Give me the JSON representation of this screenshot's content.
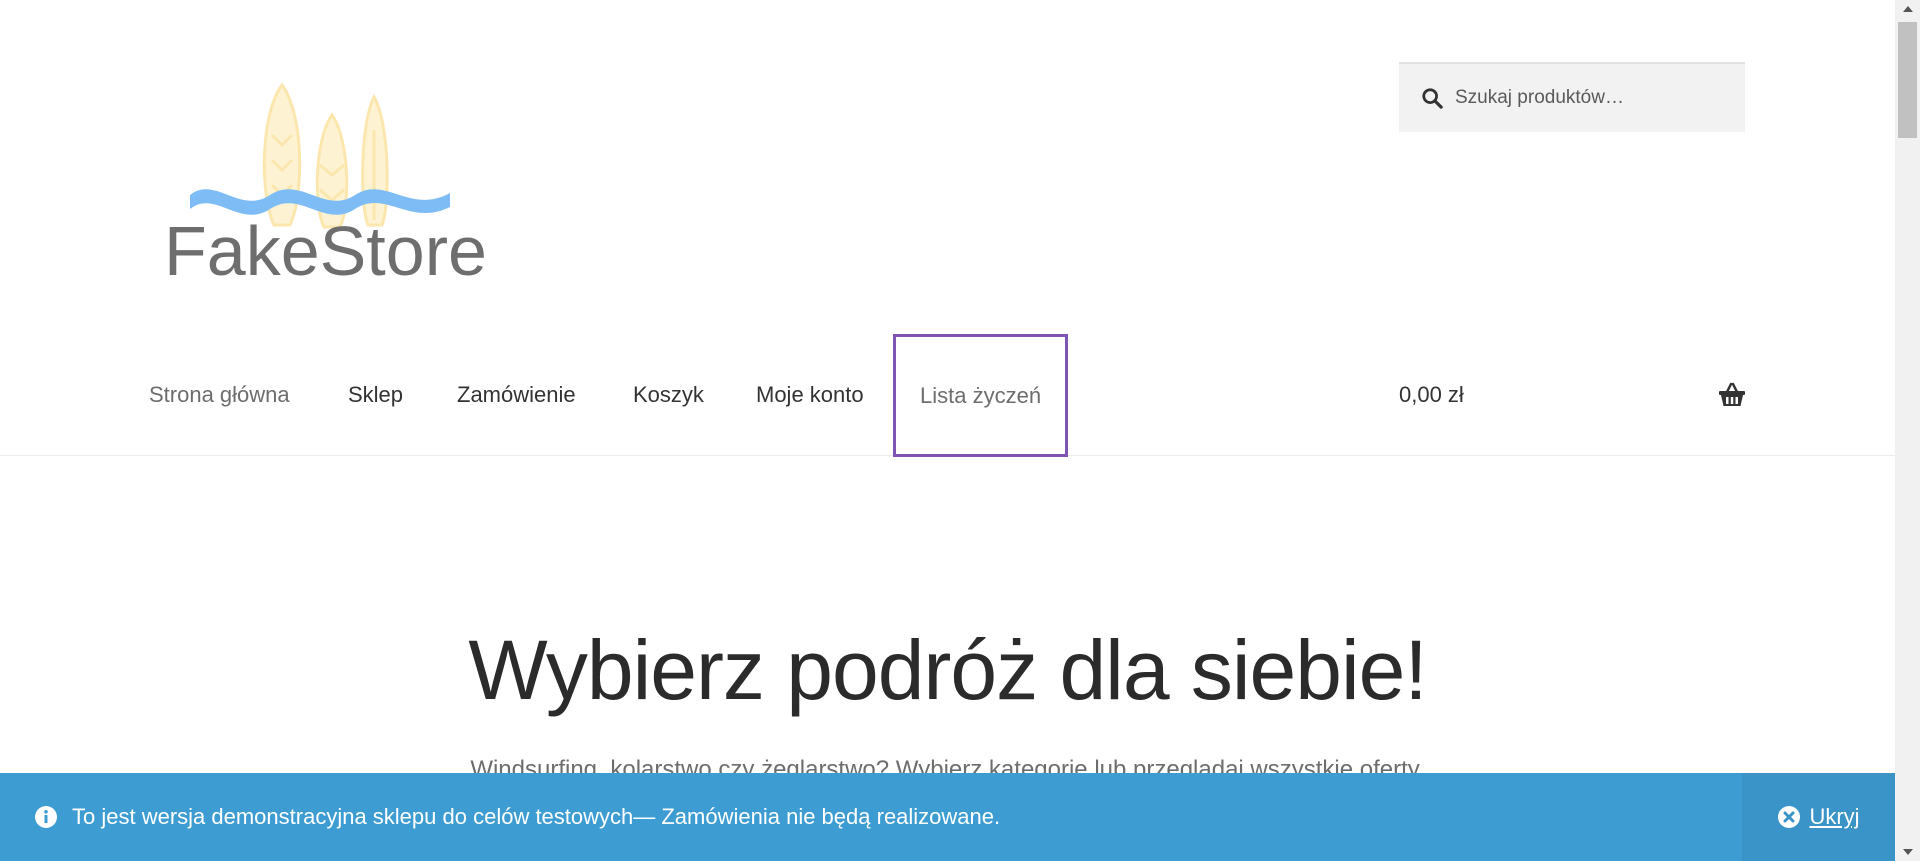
{
  "logo": {
    "text": "FakeStore"
  },
  "search": {
    "placeholder": "Szukaj produktów…"
  },
  "nav": {
    "items": [
      {
        "label": "Strona główna"
      },
      {
        "label": "Sklep"
      },
      {
        "label": "Zamówienie"
      },
      {
        "label": "Koszyk"
      },
      {
        "label": "Moje konto"
      },
      {
        "label": "Lista życzeń"
      }
    ],
    "cart_total": "0,00 zł"
  },
  "hero": {
    "title": "Wybierz podróż dla siebie!",
    "subtitle": "Windsurfing, kolarstwo czy żeglarstwo? Wybierz kategorię lub przeglądaj wszystkie oferty."
  },
  "notice": {
    "text": "To jest wersja demonstracyjna sklepu do celów testowych— Zamówienia nie będą realizowane.",
    "dismiss_label": "Ukryj"
  },
  "colors": {
    "accent_purple": "#7f54b3",
    "notice_blue": "#3d9cd2",
    "logo_text": "#6e6e6e",
    "logo_wave": "#7dbcf5",
    "logo_board": "#fbe7ae"
  },
  "icons": [
    "search-icon",
    "basket-icon",
    "info-icon",
    "close-circle-icon"
  ]
}
